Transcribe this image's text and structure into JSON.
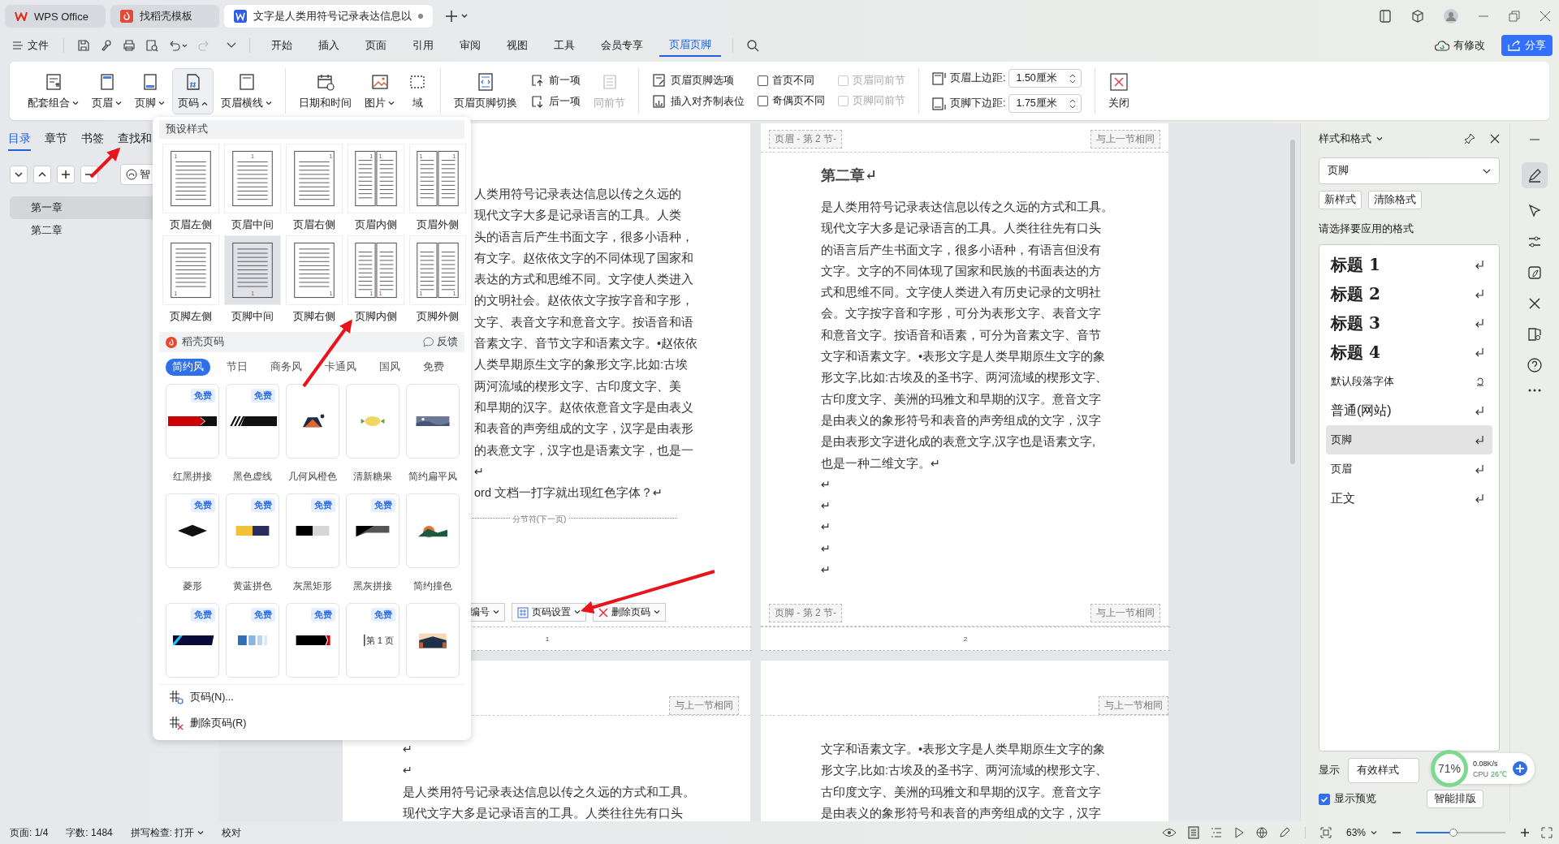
{
  "tabs": [
    {
      "label": "WPS Office",
      "kind": "home",
      "selected": false,
      "modified": false
    },
    {
      "label": "找稻壳模板",
      "kind": "template",
      "selected": false,
      "modified": false
    },
    {
      "label": "文字是人类用符号记录表达信息以",
      "kind": "doc",
      "selected": true,
      "modified": true
    }
  ],
  "menu": {
    "file": "文件",
    "items": [
      {
        "label": "开始",
        "selected": false
      },
      {
        "label": "插入",
        "selected": false
      },
      {
        "label": "页面",
        "selected": false
      },
      {
        "label": "引用",
        "selected": false
      },
      {
        "label": "审阅",
        "selected": false
      },
      {
        "label": "视图",
        "selected": false
      },
      {
        "label": "工具",
        "selected": false
      },
      {
        "label": "会员专享",
        "selected": false
      },
      {
        "label": "页眉页脚",
        "selected": true
      }
    ],
    "sync_status": "有修改",
    "share": "分享"
  },
  "ribbon": {
    "insert_tools": [
      {
        "label": "配套组合",
        "kind": "combo",
        "expanded": false
      },
      {
        "label": "页眉",
        "kind": "header",
        "expanded": false
      },
      {
        "label": "页脚",
        "kind": "footer",
        "expanded": false
      },
      {
        "label": "页码",
        "kind": "page-number",
        "expanded": true
      },
      {
        "label": "页眉横线",
        "kind": "header-line",
        "expanded": false
      }
    ],
    "content_tools": [
      {
        "label": "日期和时间",
        "kind": "calendar",
        "dropdown": false
      },
      {
        "label": "图片",
        "kind": "picture",
        "dropdown": true
      },
      {
        "label": "域",
        "kind": "field",
        "dropdown": false
      }
    ],
    "switch_tool": "页眉页脚切换",
    "nav_tools": [
      {
        "label": "前一项",
        "kind": "prev"
      },
      {
        "label": "后一项",
        "kind": "next"
      }
    ],
    "same_as_previous": {
      "label": "同前节",
      "disabled": true
    },
    "option_tools": [
      {
        "label": "页眉页脚选项",
        "kind": "options"
      },
      {
        "label": "插入对齐制表位",
        "kind": "tab-stop"
      }
    ],
    "checkboxes": [
      {
        "label": "首页不同",
        "checked": false,
        "disabled": false
      },
      {
        "label": "奇偶页不同",
        "checked": false,
        "disabled": false
      }
    ],
    "link_checkboxes": [
      {
        "label": "页眉同前节",
        "checked": false,
        "disabled": true
      },
      {
        "label": "页脚同前节",
        "checked": false,
        "disabled": true
      }
    ],
    "margins": [
      {
        "label": "页眉上边距:",
        "value": "1.50厘米",
        "kind": "top"
      },
      {
        "label": "页脚下边距:",
        "value": "1.75厘米",
        "kind": "bottom"
      }
    ],
    "close": "关闭"
  },
  "nav_panel": {
    "tabs": [
      {
        "label": "目录",
        "selected": true
      },
      {
        "label": "章节",
        "selected": false
      },
      {
        "label": "书签",
        "selected": false
      },
      {
        "label": "查找和",
        "selected": false
      }
    ],
    "smart_button": "智",
    "items": [
      {
        "label": "第一章",
        "selected": true
      },
      {
        "label": "第二章",
        "selected": false
      }
    ]
  },
  "page_number_menu": {
    "preset_title": "预设样式",
    "presets": [
      {
        "label": "页眉左侧",
        "kind": "header-left",
        "page_numbers": [
          "1"
        ],
        "selected": false
      },
      {
        "label": "页眉中间",
        "kind": "header-center",
        "page_numbers": [
          "1"
        ],
        "selected": false
      },
      {
        "label": "页眉右侧",
        "kind": "header-right",
        "page_numbers": [
          "1"
        ],
        "selected": false
      },
      {
        "label": "页眉内侧",
        "kind": "header-inside",
        "page_numbers": [
          "1",
          "1"
        ],
        "selected": false
      },
      {
        "label": "页眉外侧",
        "kind": "header-outside",
        "page_numbers": [
          "1",
          "1"
        ],
        "selected": false
      },
      {
        "label": "页脚左侧",
        "kind": "footer-left",
        "page_numbers": [
          "1"
        ],
        "selected": false
      },
      {
        "label": "页脚中间",
        "kind": "footer-center",
        "page_numbers": [
          "1"
        ],
        "selected": true
      },
      {
        "label": "页脚右侧",
        "kind": "footer-right",
        "page_numbers": [
          "1"
        ],
        "selected": false
      },
      {
        "label": "页脚内侧",
        "kind": "footer-inside",
        "page_numbers": [
          "1",
          "1"
        ],
        "selected": false
      },
      {
        "label": "页脚外侧",
        "kind": "footer-outside",
        "page_numbers": [
          "1",
          "1"
        ],
        "selected": false
      }
    ],
    "template_title": "稻壳页码",
    "feedback": "反馈",
    "categories": [
      {
        "label": "简约风",
        "selected": true
      },
      {
        "label": "节日",
        "selected": false
      },
      {
        "label": "商务风",
        "selected": false
      },
      {
        "label": "卡通风",
        "selected": false
      },
      {
        "label": "国风",
        "selected": false
      },
      {
        "label": "免费",
        "selected": false
      }
    ],
    "templates": [
      {
        "name": "红黑拼接",
        "badge": "免费",
        "kind": "red-black"
      },
      {
        "name": "黑色虚线",
        "badge": "免费",
        "kind": "black-stripes"
      },
      {
        "name": "几何风橙色",
        "kind": "orange-tent"
      },
      {
        "name": "清新糖果",
        "kind": "candy"
      },
      {
        "name": "简约扁平风",
        "kind": "landscape"
      },
      {
        "name": "菱形",
        "badge": "免费",
        "kind": "diamond"
      },
      {
        "name": "黄蓝拼色",
        "badge": "免费",
        "kind": "yellow-navy"
      },
      {
        "name": "灰黑矩形",
        "badge": "免费",
        "kind": "black-gray"
      },
      {
        "name": "黑灰拼接",
        "badge": "免费",
        "kind": "black-slant"
      },
      {
        "name": "简约撞色",
        "kind": "sunset"
      },
      {
        "badge": "免费",
        "kind": "cyan-navy"
      },
      {
        "badge": "免费",
        "kind": "blue-blocks"
      },
      {
        "badge": "免费",
        "kind": "black-red"
      },
      {
        "badge": "免费",
        "kind": "page-label",
        "caption": "第 1 页"
      },
      {
        "kind": "road"
      }
    ],
    "actions": [
      {
        "label": "页码(N)...",
        "kind": "insert"
      },
      {
        "label": "删除页码(R)",
        "kind": "delete"
      }
    ]
  },
  "pages": [
    {
      "body": [
        "人类用符号记录表达信息以传之久远的",
        "现代文字大多是记录语言的工具。人类",
        "头的语言后产生书面文字，很多小语种，",
        "有文字。赵依依文字的不同体现了国家和",
        "表达的方式和思维不同。文字使人类进入",
        "的文明社会。赵依依文字按字音和字形，",
        "文字、表音文字和意音文字。按语音和语",
        "音素文字、音节文字和语素文字。•赵依依",
        "人类早期原生文字的象形文字,比如:古埃",
        "两河流域的楔形文字、古印度文字、美",
        "和早期的汉字。赵依依意音文字是由表义",
        "和表音的声旁组成的文字，汉字是由表形",
        "的表意文字，汉字也是语素文字，也是一",
        "↵",
        "ord 文档一打字就出现红色字体？↵"
      ],
      "section_break": "分节符(下一页)",
      "footer_tools": [
        {
          "label": "编号",
          "kind": "numbering"
        },
        {
          "label": "页码设置",
          "kind": "settings"
        },
        {
          "label": "删除页码",
          "kind": "delete"
        }
      ],
      "page_number": "1"
    },
    {
      "header_tag": "页眉 - 第 2 节-",
      "header_link": "与上一节相同",
      "heading": "第二章↵",
      "body": [
        "是人类用符号记录表达信息以传之久远的方式和工具。",
        "现代文字大多是记录语言的工具。人类往往先有口头",
        "的语言后产生书面文字，很多小语种，有语言但没有",
        "文字。文字的不同体现了国家和民族的书面表达的方",
        "式和思维不同。文字使人类进入有历史记录的文明社",
        "会。文字按字音和字形，可分为表形文字、表音文字",
        "和意音文字。按语音和语素，可分为音素文字、音节",
        "文字和语素文字。•表形文字是人类早期原生文字的象",
        "形文字,比如:古埃及的圣书字、两河流域的楔形文字、",
        "古印度文字、美洲的玛雅文和早期的汉字。意音文字",
        "是由表义的象形符号和表音的声旁组成的文字，汉字",
        "是由表形文字进化成的表意文字,汉字也是语素文字,",
        "也是一种二维文字。↵",
        "↵",
        "↵",
        "↵",
        "↵",
        "↵"
      ],
      "footer_tag": "页脚 - 第 2 节-",
      "footer_link": "与上一节相同",
      "page_number": "2"
    }
  ],
  "lower_pages": [
    {
      "header_link": "与上一节相同",
      "body": [
        "↵",
        "↵",
        "是人类用符号记录表达信息以传之久远的方式和工具。",
        "现代文字大多是记录语言的工具。人类往往先有口头"
      ]
    },
    {
      "header_link": "与上一节相同",
      "body": [
        "文字和语素文字。•表形文字是人类早期原生文字的象",
        "形文字,比如:古埃及的圣书字、两河流域的楔形文字、",
        "古印度文字、美洲的玛雅文和早期的汉字。意音文字",
        "是由表义的象形符号和表音的声旁组成的文字，汉字"
      ]
    }
  ],
  "styles_panel": {
    "title": "样式和格式",
    "current": "页脚",
    "buttons": [
      "新样式",
      "清除格式"
    ],
    "prompt": "请选择要应用的格式",
    "styles": [
      {
        "label": "标题  1",
        "kind": "heading",
        "selected": false
      },
      {
        "label": "标题  2",
        "kind": "heading",
        "selected": false
      },
      {
        "label": "标题  3",
        "kind": "heading",
        "selected": false
      },
      {
        "label": "标题 4",
        "kind": "heading",
        "selected": false
      },
      {
        "label": "默认段落字体",
        "kind": "character",
        "selected": false
      },
      {
        "label": "普通(网站)",
        "kind": "large",
        "selected": false
      },
      {
        "label": "页脚",
        "kind": "paragraph",
        "selected": true
      },
      {
        "label": "页眉",
        "kind": "paragraph",
        "selected": false
      },
      {
        "label": "正文",
        "kind": "body",
        "selected": false
      }
    ],
    "show_label": "显示",
    "show_value": "有效样式",
    "preview": {
      "label": "显示预览",
      "checked": true
    },
    "smart_layout": "智能排版"
  },
  "monitor": {
    "usage": "71%",
    "speed": "0.08K/s",
    "cpu_label": "CPU",
    "temperature": "26℃"
  },
  "status_bar": {
    "page": "页面: 1/4",
    "words": "字数: 1484",
    "spell": "拼写检查: 打开",
    "proof": "校对",
    "zoom": "63%",
    "level": 0.42
  }
}
